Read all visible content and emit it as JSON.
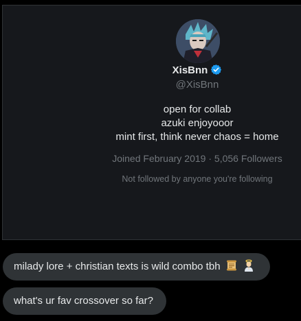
{
  "profile": {
    "display_name": "XisBnn",
    "verified": true,
    "handle": "@XisBnn",
    "bio_lines": [
      "open for collab",
      "azuki enjoyooor",
      "mint first, think never chaos = home"
    ],
    "joined": "Joined February 2019",
    "separator": "·",
    "followers": "5,056 Followers",
    "followed_by_note": "Not followed by anyone you're following"
  },
  "messages": [
    {
      "text": "milady lore + christian texts is wild combo tbh",
      "emojis": [
        "scroll-emoji",
        "praying-angel-emoji"
      ]
    },
    {
      "text": "what's ur fav crossover so far?"
    }
  ],
  "colors": {
    "background": "#000000",
    "card_bg": "#16181c",
    "card_border": "#2f3336",
    "primary_text": "#e7e9ea",
    "secondary_text": "#71767b",
    "bubble_bg": "#2f3336",
    "verified_blue": "#1d9bf0"
  }
}
